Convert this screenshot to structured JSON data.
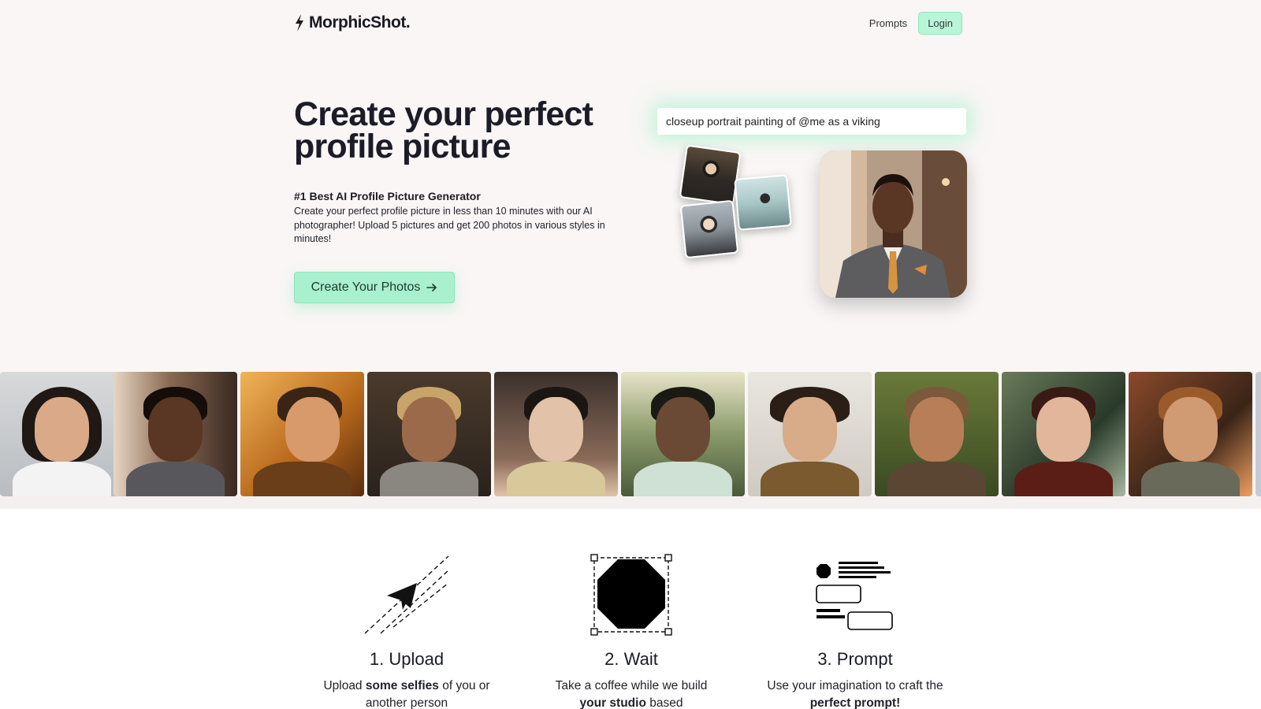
{
  "header": {
    "logo_text": "MorphicShot.",
    "nav_prompts": "Prompts",
    "nav_login": "Login"
  },
  "hero": {
    "title": "Create your perfect profile picture",
    "subtitle": "#1 Best AI Profile Picture Generator",
    "description": "Create your perfect profile picture in less than 10 minutes with our AI photographer! Upload 5 pictures and get 200 photos in various styles in minutes!",
    "cta_label": "Create Your Photos",
    "prompt_text": "closeup portrait painting of @me as a viking"
  },
  "steps": [
    {
      "title": "1. Upload",
      "desc_pre": "Upload ",
      "desc_bold": "some selfies",
      "desc_post": " of you or another person",
      "icon": "paper-plane-icon"
    },
    {
      "title": "2. Wait",
      "desc_pre": "Take a coffee while we build ",
      "desc_bold": "your studio",
      "desc_post": " based",
      "icon": "octagon-selection-icon"
    },
    {
      "title": "3. Prompt",
      "desc_pre": "Use your imagination to craft the ",
      "desc_bold": "perfect prompt!",
      "desc_post": "",
      "icon": "prompt-layout-icon"
    }
  ],
  "colors": {
    "accent_green": "#a8f0ce",
    "page_bg": "#f9f6f5"
  }
}
